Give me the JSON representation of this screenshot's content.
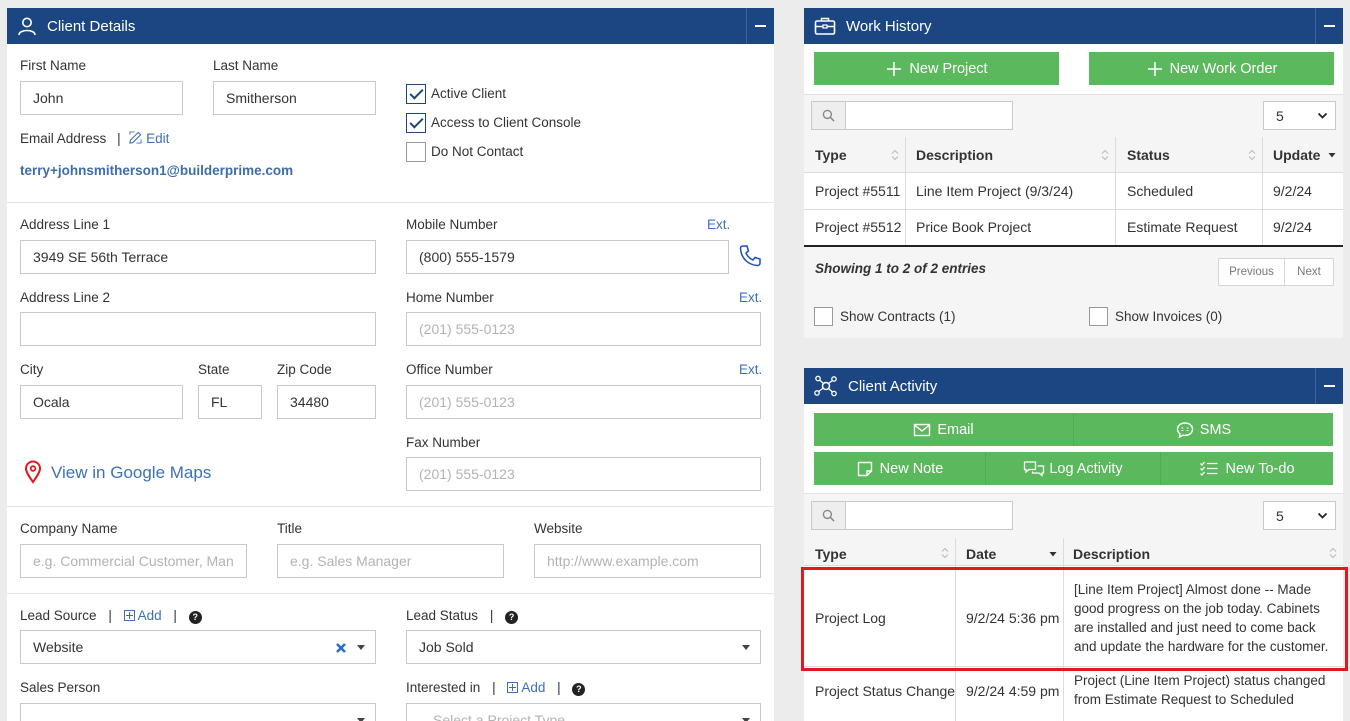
{
  "client_details": {
    "title": "Client Details",
    "first_name": {
      "label": "First Name",
      "value": "John"
    },
    "last_name": {
      "label": "Last Name",
      "value": "Smitherson"
    },
    "email": {
      "label": "Email Address",
      "edit": "Edit",
      "value": "terry+johnsmitherson1@builderprime.com"
    },
    "checkboxes": [
      {
        "label": "Active Client",
        "checked": true
      },
      {
        "label": "Access to Client Console",
        "checked": true
      },
      {
        "label": "Do Not Contact",
        "checked": false
      }
    ],
    "address1": {
      "label": "Address Line 1",
      "value": "3949 SE 56th Terrace"
    },
    "address2": {
      "label": "Address Line 2",
      "value": ""
    },
    "city": {
      "label": "City",
      "value": "Ocala"
    },
    "state": {
      "label": "State",
      "value": "FL"
    },
    "zip": {
      "label": "Zip Code",
      "value": "34480"
    },
    "mobile": {
      "label": "Mobile Number",
      "ext": "Ext.",
      "value": "(800) 555-1579"
    },
    "home": {
      "label": "Home Number",
      "ext": "Ext.",
      "placeholder": "(201) 555-0123"
    },
    "office": {
      "label": "Office Number",
      "ext": "Ext.",
      "placeholder": "(201) 555-0123"
    },
    "fax": {
      "label": "Fax Number",
      "placeholder": "(201) 555-0123"
    },
    "google_maps": "View in Google Maps",
    "company": {
      "label": "Company Name",
      "placeholder": "e.g. Commercial Customer, Man"
    },
    "job_title": {
      "label": "Title",
      "placeholder": "e.g. Sales Manager"
    },
    "website": {
      "label": "Website",
      "placeholder": "http://www.example.com"
    },
    "lead_source": {
      "label": "Lead Source",
      "add": "Add",
      "value": "Website"
    },
    "lead_status": {
      "label": "Lead Status",
      "value": "Job Sold"
    },
    "sales_person": {
      "label": "Sales Person",
      "value": ""
    },
    "interested_in": {
      "label": "Interested in",
      "add": "Add",
      "placeholder": "Select a Project Type"
    },
    "separator": "|",
    "help": "?"
  },
  "work_history": {
    "title": "Work History",
    "new_project": "New Project",
    "new_work_order": "New Work Order",
    "page_size": "5",
    "columns": [
      "Type",
      "Description",
      "Status",
      "Update"
    ],
    "rows": [
      [
        "Project #5511",
        "Line Item Project (9/3/24)",
        "Scheduled",
        "9/2/24"
      ],
      [
        "Project #5512",
        "Price Book Project",
        "Estimate Request",
        "9/2/24"
      ]
    ],
    "showing": "Showing 1 to 2 of 2 entries",
    "previous": "Previous",
    "next": "Next",
    "show_contracts": "Show Contracts (1)",
    "show_invoices": "Show Invoices (0)"
  },
  "client_activity": {
    "title": "Client Activity",
    "buttons": {
      "email": "Email",
      "sms": "SMS",
      "new_note": "New Note",
      "log_activity": "Log Activity",
      "new_todo": "New To-do"
    },
    "page_size": "5",
    "columns": [
      "Type",
      "Date",
      "Description"
    ],
    "rows": [
      [
        "Project Log",
        "9/2/24 5:36 pm",
        "[Line Item Project] Almost done -- Made good progress on the job today. Cabinets are installed and just need to come back and update the hardware for the customer."
      ],
      [
        "Project Status Change",
        "9/2/24 4:59 pm",
        "Project (Line Item Project) status changed from Estimate Request to Scheduled"
      ]
    ],
    "highlight_color": "#e0191f"
  },
  "colors": {
    "header": "#1b4682",
    "button_green": "#5cb85c",
    "link": "#3d71b6"
  }
}
